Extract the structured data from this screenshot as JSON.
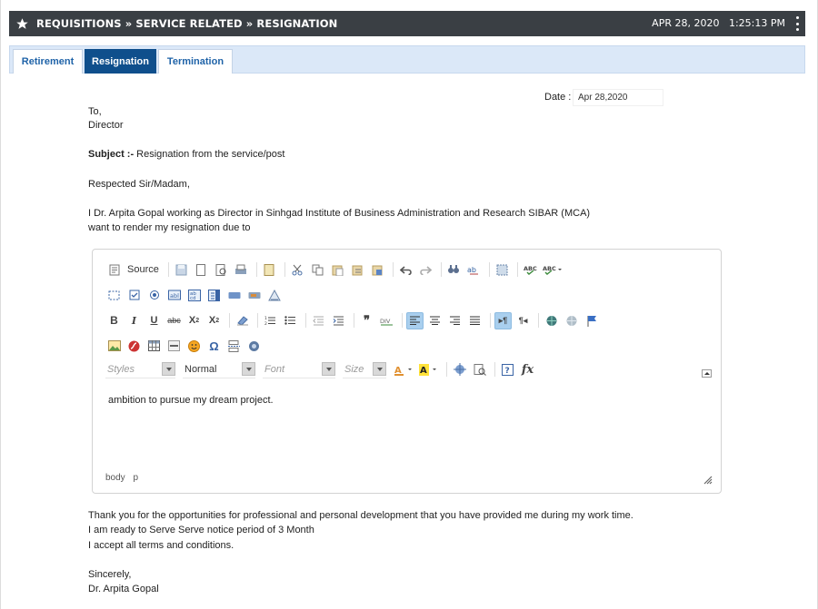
{
  "header": {
    "title": "REQUISITIONS » SERVICE RELATED » RESIGNATION",
    "date": "APR 28, 2020",
    "time": "1:25:13 PM"
  },
  "tabs": [
    {
      "label": "Retirement",
      "active": false
    },
    {
      "label": "Resignation",
      "active": true
    },
    {
      "label": "Termination",
      "active": false
    }
  ],
  "letter": {
    "date_label": "Date :",
    "date_value": "Apr 28,2020",
    "to": "To,",
    "recipient": "Director",
    "subject_label": "Subject :-",
    "subject_text": " Resignation from the service/post",
    "salutation": "Respected Sir/Madam,",
    "intro_line1": "I Dr. Arpita Gopal working as Director in Sinhgad Institute of Business Administration and Research SIBAR (MCA)",
    "intro_line2": "want to render my resignation due to",
    "thanks": "Thank you for the opportunities for professional and personal development that you have provided me during my work time.",
    "notice": "I am ready to Serve Serve notice period of 3 Month",
    "accept": "I accept all terms and conditions.",
    "closing": "Sincerely,",
    "signature": "Dr. Arpita Gopal"
  },
  "editor": {
    "source_label": "Source",
    "styles_placeholder": "Styles",
    "format_value": "Normal",
    "font_placeholder": "Font",
    "size_placeholder": "Size",
    "content": "ambition to pursue my dream project.",
    "path": [
      "body",
      "p"
    ]
  },
  "colors": {
    "titlebar_bg": "#3a3f44",
    "tab_active_bg": "#0f4f8c",
    "tab_text": "#1f63a8",
    "tabbar_bg": "#dbe8f8"
  }
}
